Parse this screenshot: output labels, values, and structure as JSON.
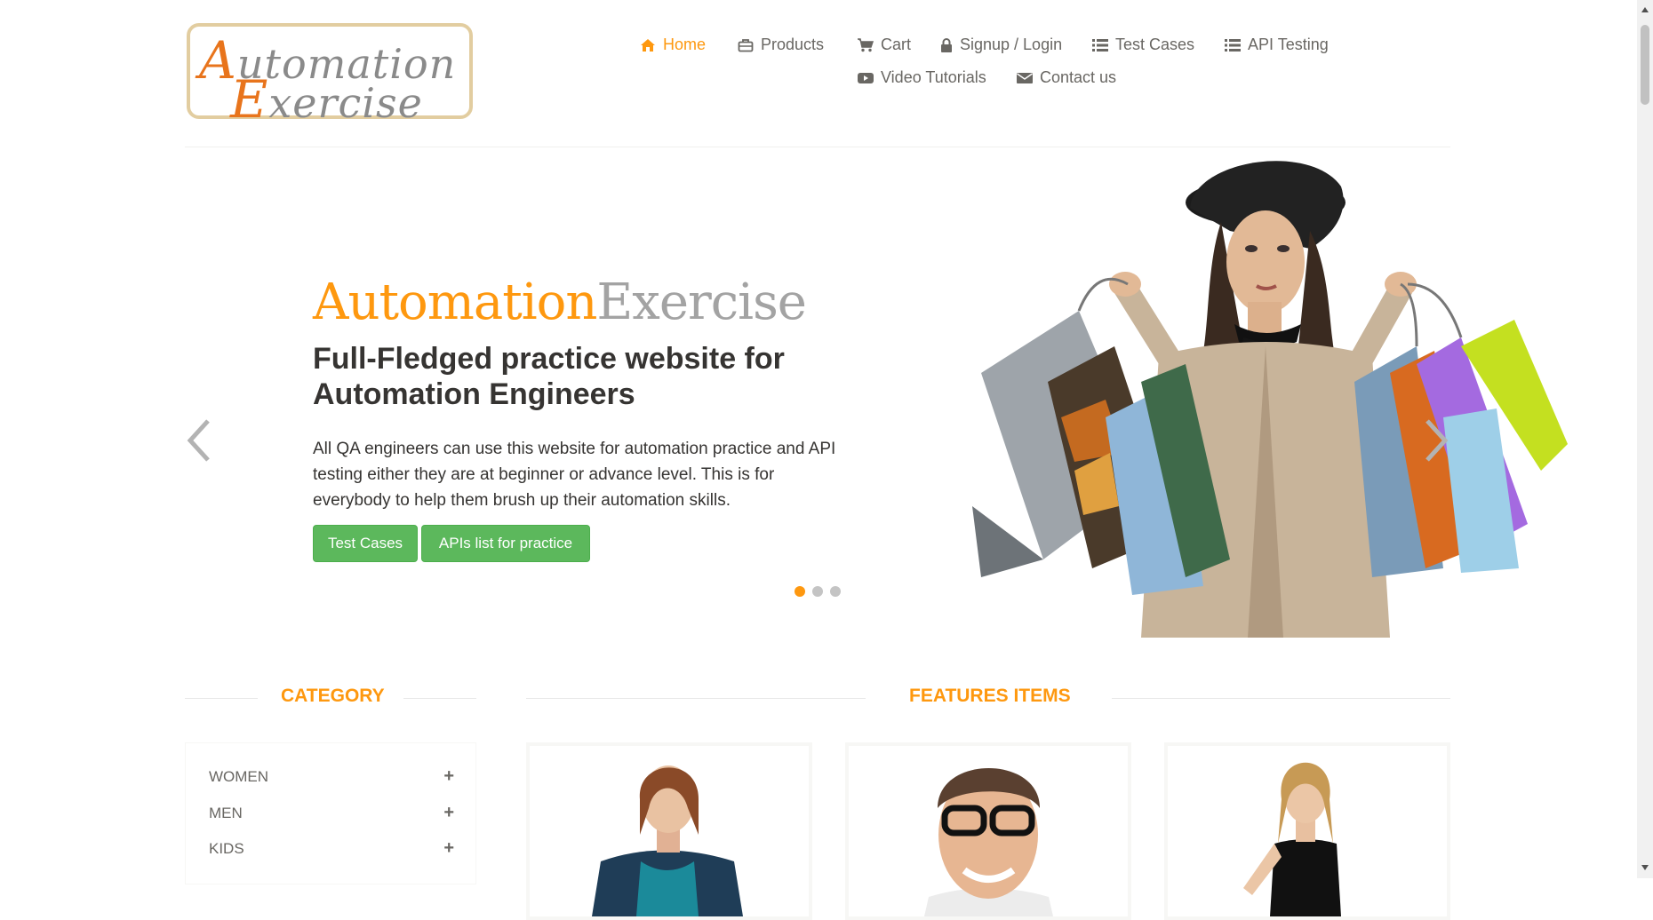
{
  "logo": {
    "text": "Automation Exercise",
    "line1_cap": "A",
    "line1_rest": "utomation",
    "line2_cap": "E",
    "line2_rest": "xercise"
  },
  "nav": [
    {
      "label": "Home",
      "icon": "home-icon",
      "active": true
    },
    {
      "label": "Products",
      "icon": "briefcase-icon"
    },
    {
      "label": "Cart",
      "icon": "cart-icon"
    },
    {
      "label": "Signup / Login",
      "icon": "lock-icon"
    },
    {
      "label": "Test Cases",
      "icon": "list-icon"
    },
    {
      "label": "API Testing",
      "icon": "list-icon"
    },
    {
      "label": "Video Tutorials",
      "icon": "youtube-play-icon"
    },
    {
      "label": "Contact us",
      "icon": "envelope-icon"
    }
  ],
  "slider": {
    "brand_part1": "Automation",
    "brand_part2": "Exercise",
    "heading": "Full-Fledged practice website for Automation Engineers",
    "text": "All QA engineers can use this website for automation practice and API testing either they are at beginner or advance level. This is for everybody to help them brush up their automation skills.",
    "buttons": [
      "Test Cases",
      "APIs list for practice"
    ],
    "active_slide": 1,
    "slide_count": 3
  },
  "category": {
    "title": "CATEGORY",
    "items": [
      "WOMEN",
      "MEN",
      "KIDS"
    ]
  },
  "features": {
    "title": "FEATURES ITEMS"
  },
  "colors": {
    "accent": "#fe980f",
    "button": "#5cb85c",
    "text": "#696763",
    "heading": "#363432"
  }
}
